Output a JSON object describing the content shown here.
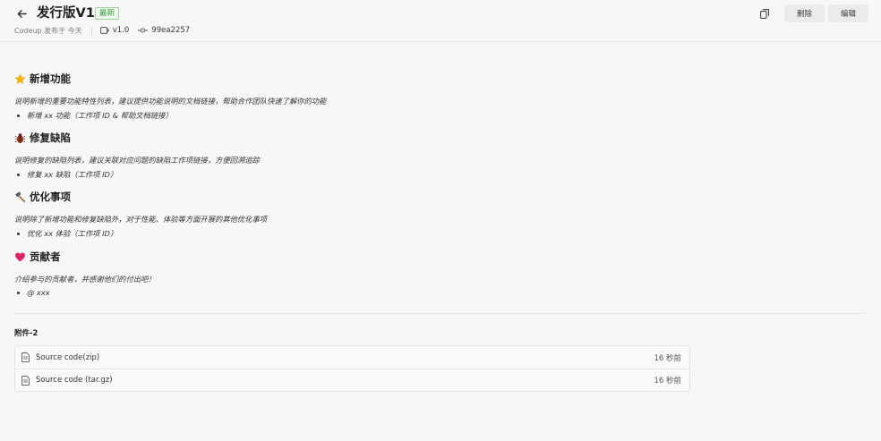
{
  "header": {
    "title": "发行版V1",
    "badge": "最新",
    "publisher": "Codeup 发布于 今天",
    "tag": "v1.0",
    "commit": "99ea2257",
    "delete_label": "删除",
    "edit_label": "编辑"
  },
  "sections": [
    {
      "icon": "star-icon",
      "title": "新增功能",
      "desc": "说明新增的重要功能特性列表，建议提供功能说明的文档链接，帮助合作团队快速了解你的功能",
      "bullet": "新增 xx 功能（工作项 ID & 帮助文档链接）"
    },
    {
      "icon": "bug-icon",
      "title": "修复缺陷",
      "desc": "说明修复的缺陷列表，建议关联对应问题的缺陷工作项链接，方便回溯追踪",
      "bullet": "修复 xx 缺陷（工作项 ID）"
    },
    {
      "icon": "hammer-icon",
      "title": "优化事项",
      "desc": "说明除了新增功能和修复缺陷外，对于性能、体验等方面开展的其他优化事项",
      "bullet": "优化 xx 体验（工作项 ID）"
    },
    {
      "icon": "heart-icon",
      "title": "贡献者",
      "desc": "介绍参与的贡献者，并感谢他们的付出吧！",
      "bullet": "@ xxx"
    }
  ],
  "attachments": {
    "title": "附件-2",
    "items": [
      {
        "name": "Source code(zip)",
        "time": "16 秒前"
      },
      {
        "name": "Source code (tar.gz)",
        "time": "16 秒前"
      }
    ]
  },
  "colors": {
    "badge_green": "#3b9b3d",
    "star": "#f5b400",
    "bug": "#8b2f1f",
    "heart": "#e0245e"
  }
}
